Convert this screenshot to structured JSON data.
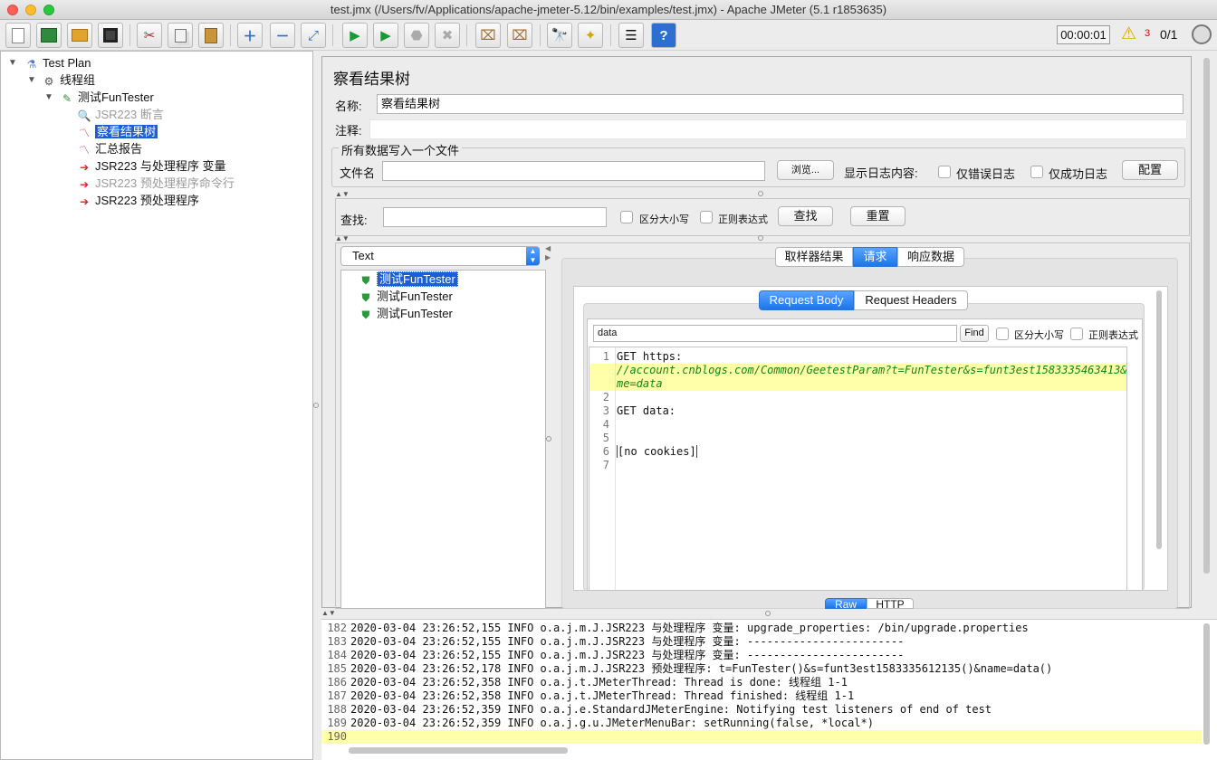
{
  "window": {
    "title": "test.jmx (/Users/fv/Applications/apache-jmeter-5.12/bin/examples/test.jmx) - Apache JMeter (5.1 r1853635)"
  },
  "toolbar": {
    "icons": [
      "new-icon",
      "templates-icon",
      "open-icon",
      "save-icon",
      "cut-icon",
      "copy-icon",
      "paste-icon",
      "expand-icon",
      "collapse-icon",
      "toggle-icon",
      "start-icon",
      "start-no-pause-icon",
      "stop-icon",
      "shutdown-icon",
      "clear-icon",
      "clear-all-icon",
      "search-icon",
      "reset-search-icon",
      "function-helper-icon",
      "help-icon"
    ],
    "timer": "00:00:01",
    "warning_count": "3",
    "threads": "0/1"
  },
  "tree": {
    "items": [
      {
        "label": "Test Plan",
        "icon": "test-plan-icon"
      },
      {
        "label": "线程组",
        "icon": "thread-group-icon"
      },
      {
        "label": "测试FunTester",
        "icon": "sampler-icon"
      },
      {
        "label": "JSR223 断言",
        "icon": "assertion-icon"
      },
      {
        "label": "察看结果树",
        "icon": "listener-icon"
      },
      {
        "label": "汇总报告",
        "icon": "report-icon"
      },
      {
        "label": "JSR223 与处理程序 变量",
        "icon": "preprocessor-icon"
      },
      {
        "label": "JSR223 预处理程序命令行",
        "icon": "preprocessor-icon"
      },
      {
        "label": "JSR223 预处理程序",
        "icon": "preprocessor-icon"
      }
    ]
  },
  "panel": {
    "title": "察看结果树",
    "name_label": "名称:",
    "name_value": "察看结果树",
    "comment_label": "注释:",
    "file_group_title": "所有数据写入一个文件",
    "filename_label": "文件名",
    "browse_button": "浏览...",
    "log_content_label": "显示日志内容:",
    "errors_only": "仅错误日志",
    "success_only": "仅成功日志",
    "config_button": "配置",
    "search_label": "查找:",
    "case_sensitive": "区分大小写",
    "regex": "正则表达式",
    "find_button": "查找",
    "reset_button": "重置"
  },
  "results": {
    "renderer": "Text",
    "samples": [
      "测试FunTester",
      "测试FunTester",
      "测试FunTester"
    ],
    "tabs": [
      "取样器结果",
      "请求",
      "响应数据"
    ],
    "active_tab": "请求",
    "subtabs": [
      "Request Body",
      "Request Headers"
    ],
    "active_subtab": "Request Body",
    "find_value": "data",
    "find_button": "Find",
    "find_case": "区分大小写",
    "find_regex": "正则表达式",
    "bottom_tabs": [
      "Raw",
      "HTTP"
    ],
    "code_lines": [
      {
        "n": "1",
        "text": "GET https:"
      },
      {
        "n": "",
        "text": "//account.cnblogs.com/Common/GeetestParam?t=FunTester&s=funt3est1583335463413&na"
      },
      {
        "n": "",
        "text": "me=data"
      },
      {
        "n": "2",
        "text": ""
      },
      {
        "n": "3",
        "text": "GET data:"
      },
      {
        "n": "4",
        "text": ""
      },
      {
        "n": "5",
        "text": ""
      },
      {
        "n": "6",
        "text": "[no cookies]"
      },
      {
        "n": "7",
        "text": ""
      }
    ]
  },
  "log": {
    "lines": [
      {
        "n": "182",
        "text": "2020-03-04 23:26:52,155 INFO o.a.j.m.J.JSR223 与处理程序 变量: upgrade_properties: /bin/upgrade.properties"
      },
      {
        "n": "183",
        "text": "2020-03-04 23:26:52,155 INFO o.a.j.m.J.JSR223 与处理程序 变量: ------------------------"
      },
      {
        "n": "184",
        "text": "2020-03-04 23:26:52,155 INFO o.a.j.m.J.JSR223 与处理程序 变量: ------------------------"
      },
      {
        "n": "185",
        "text": "2020-03-04 23:26:52,178 INFO o.a.j.m.J.JSR223 预处理程序: t=FunTester()&s=funt3est1583335612135()&name=data()"
      },
      {
        "n": "186",
        "text": "2020-03-04 23:26:52,358 INFO o.a.j.t.JMeterThread: Thread is done: 线程组 1-1"
      },
      {
        "n": "187",
        "text": "2020-03-04 23:26:52,358 INFO o.a.j.t.JMeterThread: Thread finished: 线程组 1-1"
      },
      {
        "n": "188",
        "text": "2020-03-04 23:26:52,359 INFO o.a.j.e.StandardJMeterEngine: Notifying test listeners of end of test"
      },
      {
        "n": "189",
        "text": "2020-03-04 23:26:52,359 INFO o.a.j.g.u.JMeterMenuBar: setRunning(false, *local*)"
      },
      {
        "n": "190",
        "text": ""
      }
    ]
  },
  "colors": {
    "selection": "#1b5fd6",
    "highlight_line": "#ffffaa",
    "url_green": "#118811",
    "warning": "#e0a800"
  }
}
